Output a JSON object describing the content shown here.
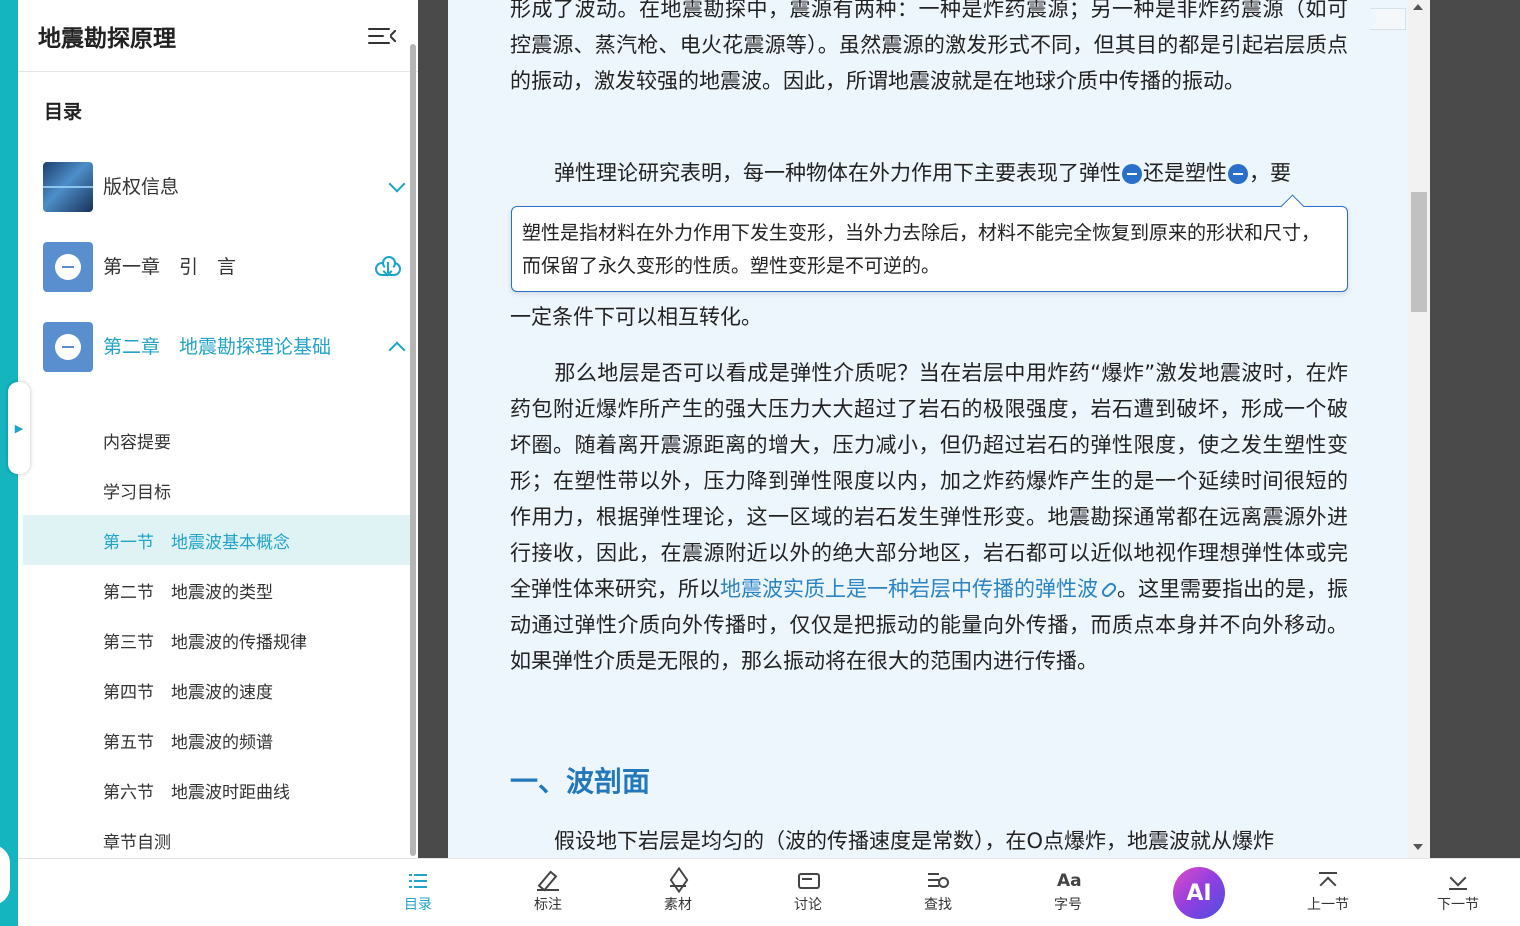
{
  "sidebar": {
    "title": "地震勘探原理",
    "toc_label": "目录",
    "chapters": [
      {
        "title": "版权信息"
      },
      {
        "title": "第一章　引　言"
      },
      {
        "title": "第二章　地震勘探理论基础"
      }
    ],
    "sections": [
      "内容提要",
      "学习目标",
      "第一节　地震波基本概念",
      "第二节　地震波的类型",
      "第三节　地震波的传播规律",
      "第四节　地震波的速度",
      "第五节　地震波的频谱",
      "第六节　地震波时距曲线",
      "章节自测"
    ]
  },
  "content": {
    "p1": "形成了波动。在地震勘探中，震源有两种：一种是炸药震源；另一种是非炸药震源（如可控震源、蒸汽枪、电火花震源等）。虽然震源的激发形式不同，但其目的都是引起岩层质点的振动，激发较强的地震波。因此，所谓地震波就是在地球介质中传播的振动。",
    "p2_a": "弹性理论研究表明，每一种物体在外力作用下主要表现了弹性",
    "p2_b": "还是塑性",
    "p2_c": "，要",
    "p2_end": "一定条件下可以相互转化。",
    "tooltip": "塑性是指材料在外力作用下发生变形，当外力去除后，材料不能完全恢复到原来的形状和尺寸，而保留了永久变形的性质。塑性变形是不可逆的。",
    "p3_a": "那么地层是否可以看成是弹性介质呢？当在岩层中用炸药“爆炸”激发地震波时，在炸药包附近爆炸所产生的强大压力大大超过了岩石的极限强度，岩石遭到破坏，形成一个破坏圈。随着离开震源距离的增大，压力减小，但仍超过岩石的弹性限度，使之发生塑性变形；在塑性带以外，压力降到弹性限度以内，加之炸药爆炸产生的是一个延续时间很短的作用力，根据弹性理论，这一区域的岩石发生弹性形变。地震勘探通常都在远离震源外进行接收，因此，在震源附近以外的绝大部分地区，岩石都可以近似地视作理想弹性体或完全弹性体来研究，所以",
    "p3_link": "地震波实质上是一种岩层中传播的弹性波",
    "p3_b": "。这里需要指出的是，振动通过弹性介质向外传播时，仅仅是把振动的能量向外传播，而质点本身并不向外移动。如果弹性介质是无限的，那么振动将在很大的范围内进行传播。",
    "heading": "一、波剖面",
    "p4": "假设地下岩层是均匀的（波的传播速度是常数），在O点爆炸，地震波就从爆炸"
  },
  "toolbar": {
    "toc": "目录",
    "annotate": "标注",
    "material": "素材",
    "discuss": "讨论",
    "search": "查找",
    "font": "字号",
    "ai": "AI",
    "prev": "上一节",
    "next": "下一节"
  }
}
